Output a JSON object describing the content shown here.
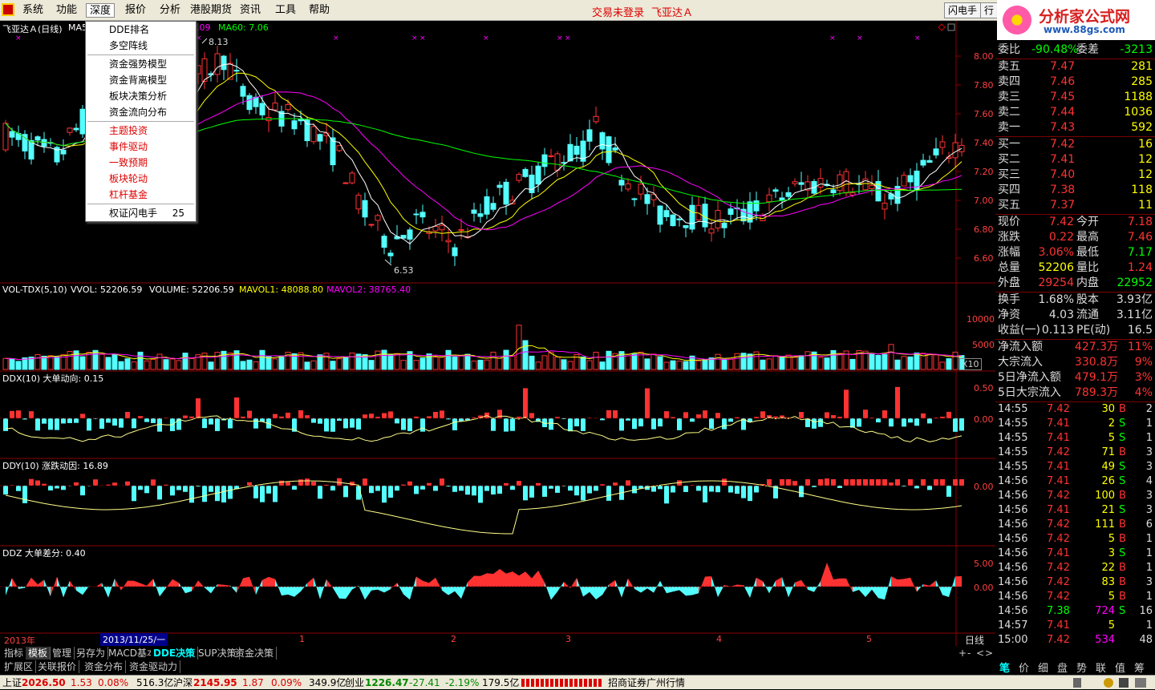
{
  "menubar": {
    "items": [
      "系统",
      "功能",
      "深度",
      "报价",
      "分析",
      "港股期货",
      "资讯",
      "工具",
      "帮助"
    ],
    "active": "深度",
    "login_notice": "交易未登录",
    "stock_name": "飞亚达Ａ",
    "flash_btn": "闪电手",
    "trade_btn": "行"
  },
  "brand": {
    "title": "分析家公式网",
    "url": "www.88gs.com"
  },
  "chart": {
    "header": "飞亚达Ａ(日线)",
    "ma_label_1": "MA5",
    "ma_label_2": ".09",
    "ma60_label": "MA60: 7.06",
    "high_mark": "8.13",
    "low_mark": "6.53",
    "price_axis": [
      "8.00",
      "7.80",
      "7.60",
      "7.40",
      "7.20",
      "7.00",
      "6.80",
      "6.60"
    ],
    "vol_header": {
      "name": "VOL-TDX(5,10)",
      "vvol": "VVOL: 52206.59",
      "volume": "VOLUME: 52206.59",
      "mavol1": "MAVOL1: 48088.80",
      "mavol2": "MAVOL2: 38765.40"
    },
    "vol_axis": [
      "10000",
      "5000"
    ],
    "vol_unit": "X10",
    "ddx_header": "DDX(10)  大单动向: 0.15",
    "ddx_axis": [
      "0.50",
      "0.00"
    ],
    "ddy_header": "DDY(10)  涨跌动因: 16.89",
    "ddy_axis": [
      "0.00"
    ],
    "ddz_header": "DDZ  大单差分: 0.40",
    "ddz_axis": [
      "5.00",
      "0.00"
    ],
    "year_label": "2013年",
    "date_label": "2013/11/25/一",
    "month_labels": [
      "1",
      "2",
      "3",
      "4",
      "5"
    ],
    "period_label": "日线",
    "colors": {
      "up": "#ff3232",
      "down": "#54ffff",
      "ma5": "#ffffff",
      "ma10": "#ffff00",
      "ma20": "#ff00ff",
      "ma60": "#00ff00",
      "grid": "#8b0000"
    }
  },
  "deep_menu": {
    "items": [
      {
        "label": "DDE排名",
        "red": false
      },
      {
        "label": "多空阵线",
        "red": false
      },
      {
        "sep": true
      },
      {
        "label": "资金强势模型",
        "red": false
      },
      {
        "label": "资金背离模型",
        "red": false
      },
      {
        "label": "板块决策分析",
        "red": false
      },
      {
        "label": "资金流向分布",
        "red": false
      },
      {
        "sep": true
      },
      {
        "label": "主题投资",
        "red": true
      },
      {
        "label": "事件驱动",
        "red": true
      },
      {
        "label": "一致预期",
        "red": true
      },
      {
        "label": "板块轮动",
        "red": true
      },
      {
        "label": "杠杆基金",
        "red": true
      },
      {
        "sep": true
      },
      {
        "label": "权证闪电手",
        "red": false,
        "shortcut": "25"
      }
    ]
  },
  "quote": {
    "weibi": {
      "label": "委比",
      "value": "-90.48%",
      "label2": "委差",
      "value2": "-3213"
    },
    "sell": [
      {
        "label": "卖五",
        "price": "7.47",
        "vol": "281"
      },
      {
        "label": "卖四",
        "price": "7.46",
        "vol": "285"
      },
      {
        "label": "卖三",
        "price": "7.45",
        "vol": "1188"
      },
      {
        "label": "卖二",
        "price": "7.44",
        "vol": "1036"
      },
      {
        "label": "卖一",
        "price": "7.43",
        "vol": "592"
      }
    ],
    "buy": [
      {
        "label": "买一",
        "price": "7.42",
        "vol": "16"
      },
      {
        "label": "买二",
        "price": "7.41",
        "vol": "12"
      },
      {
        "label": "买三",
        "price": "7.40",
        "vol": "12"
      },
      {
        "label": "买四",
        "price": "7.38",
        "vol": "118"
      },
      {
        "label": "买五",
        "price": "7.37",
        "vol": "11"
      }
    ],
    "stats": [
      {
        "l1": "现价",
        "v1": "7.42",
        "l2": "今开",
        "v2": "7.18"
      },
      {
        "l1": "涨跌",
        "v1": "0.22",
        "l2": "最高",
        "v2": "7.46"
      },
      {
        "l1": "涨幅",
        "v1": "3.06%",
        "l2": "最低",
        "v2": "7.17"
      },
      {
        "l1": "总量",
        "v1": "52206",
        "l2": "量比",
        "v2": "1.24"
      },
      {
        "l1": "外盘",
        "v1": "29254",
        "l2": "内盘",
        "v2": "22952"
      }
    ],
    "fin": [
      {
        "l1": "换手",
        "v1": "1.68%",
        "l2": "股本",
        "v2": "3.93亿"
      },
      {
        "l1": "净资",
        "v1": "4.03",
        "l2": "流通",
        "v2": "3.11亿"
      },
      {
        "l1": "收益(一)",
        "v1": "0.113",
        "l2": "PE(动)",
        "v2": "16.5"
      }
    ],
    "flow": [
      {
        "label": "净流入额",
        "value": "427.3万",
        "pct": "11%"
      },
      {
        "label": "大宗流入",
        "value": "330.8万",
        "pct": "9%"
      },
      {
        "label": "5日净流入额",
        "value": "479.1万",
        "pct": "3%"
      },
      {
        "label": "5日大宗流入",
        "value": "789.3万",
        "pct": "4%"
      }
    ],
    "ticks": [
      {
        "t": "14:55",
        "p": "7.42",
        "v": "30",
        "s": "B",
        "n": "2"
      },
      {
        "t": "14:55",
        "p": "7.41",
        "v": "2",
        "s": "S",
        "n": "1"
      },
      {
        "t": "14:55",
        "p": "7.41",
        "v": "5",
        "s": "S",
        "n": "1"
      },
      {
        "t": "14:55",
        "p": "7.42",
        "v": "71",
        "s": "B",
        "n": "3"
      },
      {
        "t": "14:55",
        "p": "7.41",
        "v": "49",
        "s": "S",
        "n": "3"
      },
      {
        "t": "14:56",
        "p": "7.41",
        "v": "26",
        "s": "S",
        "n": "4"
      },
      {
        "t": "14:56",
        "p": "7.42",
        "v": "100",
        "s": "B",
        "n": "3"
      },
      {
        "t": "14:56",
        "p": "7.41",
        "v": "21",
        "s": "S",
        "n": "3"
      },
      {
        "t": "14:56",
        "p": "7.42",
        "v": "111",
        "s": "B",
        "n": "6"
      },
      {
        "t": "14:56",
        "p": "7.42",
        "v": "5",
        "s": "B",
        "n": "1"
      },
      {
        "t": "14:56",
        "p": "7.41",
        "v": "3",
        "s": "S",
        "n": "1"
      },
      {
        "t": "14:56",
        "p": "7.42",
        "v": "22",
        "s": "B",
        "n": "1"
      },
      {
        "t": "14:56",
        "p": "7.42",
        "v": "83",
        "s": "B",
        "n": "3"
      },
      {
        "t": "14:56",
        "p": "7.42",
        "v": "5",
        "s": "B",
        "n": "1"
      },
      {
        "t": "14:56",
        "p": "7.38",
        "v": "724",
        "s": "S",
        "n": "16"
      },
      {
        "t": "14:57",
        "p": "7.41",
        "v": "5",
        "s": "",
        "n": "1"
      },
      {
        "t": "15:00",
        "p": "7.42",
        "v": "534",
        "s": "",
        "n": "48"
      }
    ],
    "tabs": [
      "笔",
      "价",
      "细",
      "盘",
      "势",
      "联",
      "值",
      "筹"
    ]
  },
  "bottom_tabs": {
    "row1": [
      "指标",
      "模板",
      "管理",
      "另存为",
      "MACD基本",
      "DDE决策",
      "SUP决策",
      "资金决策"
    ],
    "row1_selected": "DDE决策",
    "row2": [
      "扩展区",
      "关联报价",
      "资金分布",
      "资金驱动力"
    ],
    "nav": [
      "+",
      "-",
      "<",
      ">"
    ]
  },
  "statusbar": {
    "sh_label": "上证",
    "sh_val": "2026.50",
    "sh_chg": "1.53",
    "sh_pct": "0.08%",
    "sh_amt": "516.3亿",
    "sz_label": "沪深",
    "sz_val": "2145.95",
    "sz_chg": "1.87",
    "sz_pct": "0.09%",
    "sz_amt": "349.9亿",
    "cy_label": "创业",
    "cy_val": "1226.47",
    "cy_chg": "-27.41",
    "cy_pct": "-2.19%",
    "cy_amt": "179.5亿",
    "broker": "招商证券广州行情"
  }
}
